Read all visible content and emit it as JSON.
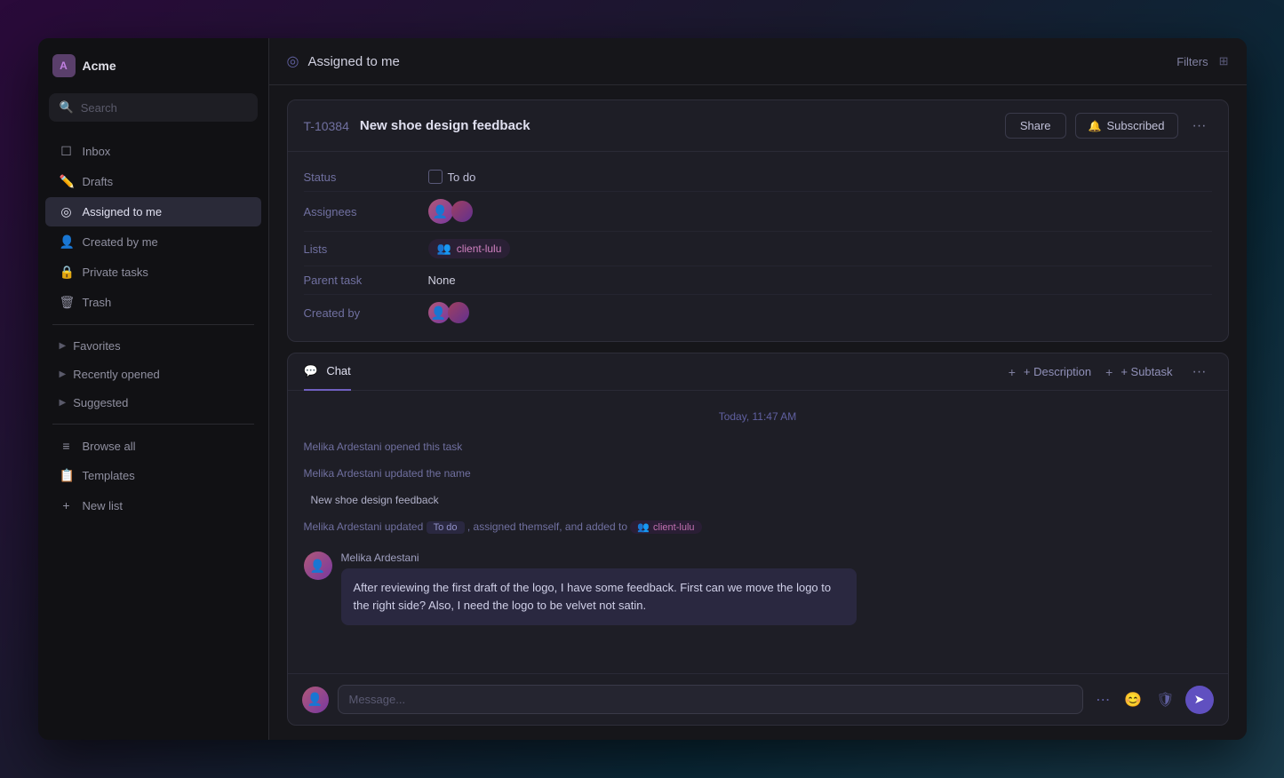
{
  "app": {
    "workspace": "Acme"
  },
  "sidebar": {
    "search_placeholder": "Search",
    "nav_items": [
      {
        "id": "inbox",
        "label": "Inbox",
        "icon": "inbox"
      },
      {
        "id": "drafts",
        "label": "Drafts",
        "icon": "drafts"
      },
      {
        "id": "assigned-to-me",
        "label": "Assigned to me",
        "icon": "assigned",
        "active": true
      },
      {
        "id": "created-by-me",
        "label": "Created by me",
        "icon": "created"
      },
      {
        "id": "private-tasks",
        "label": "Private tasks",
        "icon": "lock"
      },
      {
        "id": "trash",
        "label": "Trash",
        "icon": "trash"
      }
    ],
    "sections": [
      {
        "id": "favorites",
        "label": "Favorites"
      },
      {
        "id": "recently-opened",
        "label": "Recently opened"
      },
      {
        "id": "suggested",
        "label": "Suggested"
      }
    ],
    "bottom_items": [
      {
        "id": "browse-all",
        "label": "Browse all",
        "icon": "list"
      },
      {
        "id": "templates",
        "label": "Templates",
        "icon": "template"
      },
      {
        "id": "new-list",
        "label": "New list",
        "icon": "plus"
      }
    ]
  },
  "main_header": {
    "title": "Assigned to me",
    "filters_label": "Filters"
  },
  "task": {
    "id": "T-10384",
    "title": "New shoe design feedback",
    "share_label": "Share",
    "subscribed_label": "Subscribed",
    "more_label": "···",
    "properties": {
      "status_label": "Status",
      "status_value": "To do",
      "assignees_label": "Assignees",
      "lists_label": "Lists",
      "list_value": "client-lulu",
      "parent_task_label": "Parent task",
      "parent_task_value": "None",
      "created_by_label": "Created by"
    }
  },
  "chat": {
    "tab_label": "Chat",
    "description_btn": "+ Description",
    "subtask_btn": "+ Subtask",
    "timestamp": "Today, 11:47 AM",
    "system_messages": [
      {
        "id": "sm1",
        "text": "Melika Ardestani opened this task"
      },
      {
        "id": "sm2",
        "text": "Melika Ardestani updated the name"
      },
      {
        "id": "sm3",
        "text": "New shoe design feedback"
      },
      {
        "id": "sm4_pre",
        "text": "Melika Ardestani updated",
        "status": "To do",
        "post": ", assigned themself, and added to",
        "list": "client-lulu"
      }
    ],
    "user_message": {
      "author": "Melika Ardestani",
      "text": "After reviewing the first draft of the logo, I have some feedback. First can we move the logo to the right side? Also, I need the logo to be velvet not satin."
    },
    "message_placeholder": "Message..."
  }
}
